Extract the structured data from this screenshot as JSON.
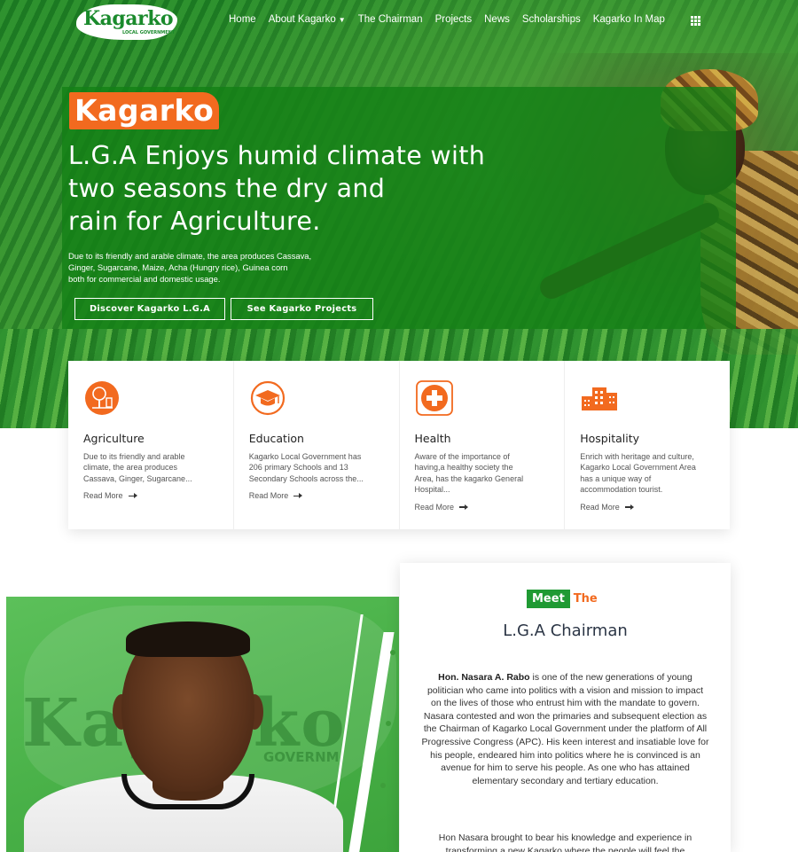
{
  "brand": {
    "logo_text": "Kagarko",
    "logo_subtext": "LOCAL GOVERNMENT",
    "primary_color": "#1f9a33",
    "accent_color": "#f26a1f"
  },
  "nav": {
    "items": [
      {
        "label": "Home"
      },
      {
        "label": "About Kagarko"
      },
      {
        "label": "The Chairman"
      },
      {
        "label": "Projects"
      },
      {
        "label": "News"
      },
      {
        "label": "Scholarships"
      },
      {
        "label": "Kagarko In Map"
      }
    ],
    "menu_icon": "grid-icon"
  },
  "hero": {
    "badge": "Kagarko",
    "headline_lines": [
      "L.G.A Enjoys humid climate with",
      "two seasons the dry and",
      "rain for Agriculture."
    ],
    "description_lines": [
      "Due to its friendly and arable climate, the area produces Cassava,",
      "Ginger, Sugarcane, Maize, Acha (Hungry rice), Guinea corn",
      "both for commercial and domestic usage."
    ],
    "buttons": {
      "discover": "Discover Kagarko L.G.A",
      "projects": "See Kagarko Projects"
    }
  },
  "features": [
    {
      "icon": "tree-icon",
      "title": "Agriculture",
      "text_lines": [
        "Due to its friendly and arable",
        "climate, the area produces",
        "Cassava, Ginger, Sugarcane..."
      ],
      "link": "Read More"
    },
    {
      "icon": "graduation-cap-icon",
      "title": "Education",
      "text_lines": [
        "Kagarko Local Government has",
        "206 primary Schools and 13",
        "Secondary Schools across the..."
      ],
      "link": "Read More"
    },
    {
      "icon": "medical-cross-icon",
      "title": "Health",
      "text_lines": [
        "Aware of the importance of",
        "having,a healthy society the",
        "Area, has the kagarko General",
        "Hospital..."
      ],
      "link": "Read More"
    },
    {
      "icon": "hotel-building-icon",
      "title": "Hospitality",
      "text_lines": [
        "Enrich with heritage and culture,",
        "Kagarko Local Government Area",
        "has a unique way of",
        "accommodation tourist."
      ],
      "link": "Read More"
    }
  ],
  "chairman": {
    "watermark": "Kagarko",
    "watermark_sub": "GOVERNM",
    "meet_green": "Meet",
    "meet_orange": "The",
    "title": "L.G.A Chairman",
    "bio_name": "Hon. Nasara A. Rabo",
    "bio_rest": " is one of the new generations of young politician who came into politics with a vision and mission to impact on the lives of those who entrust him with the mandate to govern. Nasara contested and won the primaries and subsequent election as the Chairman of Kagarko Local Government under the platform of All Progressive Congress (APC). His keen interest and insatiable love for his people, endeared him into politics where he is convinced is an avenue for him to serve his people. As one who has attained elementary secondary and tertiary education.",
    "bio2": "Hon Nasara brought to bear his knowledge and experience in transforming a new Kagarko where the people will feel the"
  }
}
